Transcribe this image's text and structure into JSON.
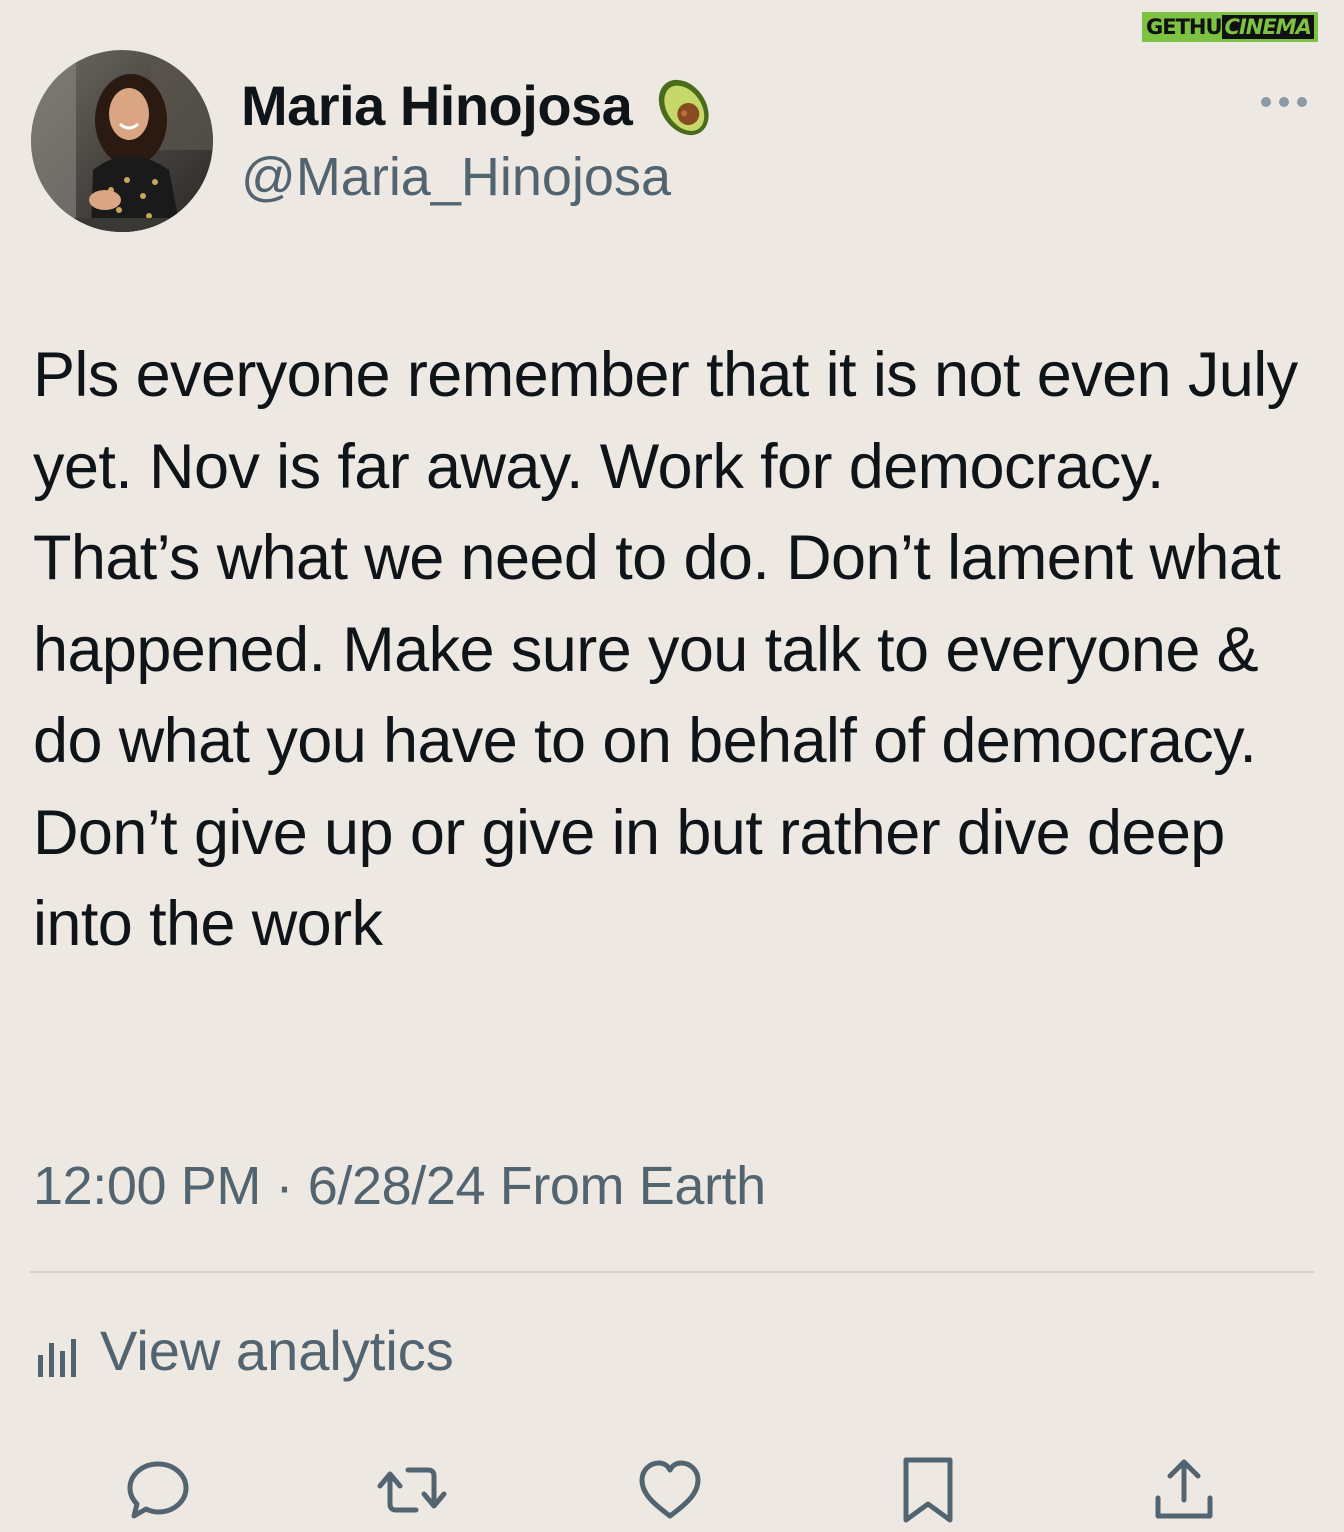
{
  "watermark": {
    "part1": "GETHU",
    "part2": "CINEMA"
  },
  "author": {
    "display_name": "Maria Hinojosa",
    "handle": "@Maria_Hinojosa",
    "badge_icon": "avocado-icon",
    "avatar_icon": "profile-photo"
  },
  "tweet": {
    "text": "Pls everyone remember that it is not even July yet. Nov is far away. Work for democracy. That’s what we need to do. Don’t lament what happened. Make sure you talk to everyone & do what you have to on behalf of democracy. Don’t give up or give in but rather dive deep into the work",
    "time": "12:00 PM",
    "separator": "·",
    "date": "6/28/24",
    "source": "From Earth"
  },
  "analytics": {
    "label": "View analytics",
    "icon": "bar-chart-icon"
  },
  "actions": [
    {
      "name": "reply",
      "icon": "reply-icon"
    },
    {
      "name": "retweet",
      "icon": "retweet-icon"
    },
    {
      "name": "like",
      "icon": "heart-icon"
    },
    {
      "name": "bookmark",
      "icon": "bookmark-icon"
    },
    {
      "name": "share",
      "icon": "share-icon"
    }
  ],
  "colors": {
    "background": "#eee8e3",
    "text_primary": "#0f1419",
    "text_secondary": "#536471",
    "icon_color": "#536471"
  }
}
